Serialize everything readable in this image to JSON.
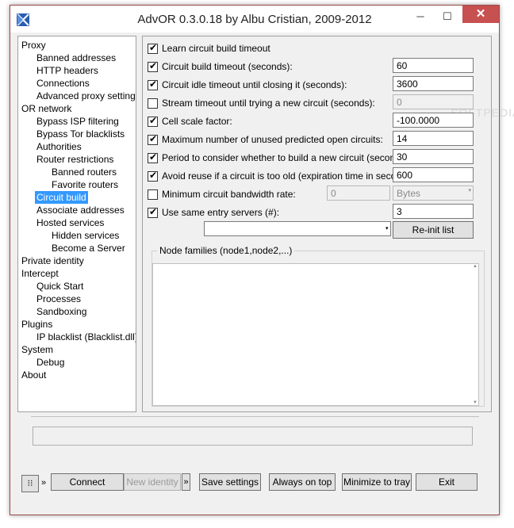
{
  "window": {
    "title": "AdvOR  0.3.0.18 by Albu Cristian, 2009-2012",
    "minimize_glyph": "─",
    "maximize_glyph": "☐",
    "close_glyph": "✕"
  },
  "watermark": "SOFTPEDIA",
  "tree": {
    "items": [
      {
        "label": "Proxy",
        "indent": 0
      },
      {
        "label": "Banned addresses",
        "indent": 1
      },
      {
        "label": "HTTP headers",
        "indent": 1
      },
      {
        "label": "Connections",
        "indent": 1
      },
      {
        "label": "Advanced proxy settings",
        "indent": 1
      },
      {
        "label": "OR network",
        "indent": 0
      },
      {
        "label": "Bypass ISP filtering",
        "indent": 1
      },
      {
        "label": "Bypass Tor blacklists",
        "indent": 1
      },
      {
        "label": "Authorities",
        "indent": 1
      },
      {
        "label": "Router restrictions",
        "indent": 1
      },
      {
        "label": "Banned routers",
        "indent": 2
      },
      {
        "label": "Favorite routers",
        "indent": 2
      },
      {
        "label": "Circuit build",
        "indent": 1,
        "selected": true
      },
      {
        "label": "Associate addresses",
        "indent": 1
      },
      {
        "label": "Hosted services",
        "indent": 1
      },
      {
        "label": "Hidden services",
        "indent": 2
      },
      {
        "label": "Become a Server",
        "indent": 2
      },
      {
        "label": "Private identity",
        "indent": 0
      },
      {
        "label": "Intercept",
        "indent": 0
      },
      {
        "label": "Quick Start",
        "indent": 1
      },
      {
        "label": "Processes",
        "indent": 1
      },
      {
        "label": "Sandboxing",
        "indent": 1
      },
      {
        "label": "Plugins",
        "indent": 0
      },
      {
        "label": "IP blacklist (Blacklist.dll)",
        "indent": 1
      },
      {
        "label": "System",
        "indent": 0
      },
      {
        "label": "Debug",
        "indent": 1
      },
      {
        "label": "About",
        "indent": 0
      }
    ]
  },
  "settings": {
    "learn_timeout": {
      "label": "Learn circuit build timeout",
      "checked": true
    },
    "build_timeout": {
      "label": "Circuit build timeout (seconds):",
      "checked": true,
      "value": "60"
    },
    "idle_timeout": {
      "label": "Circuit idle timeout until closing it (seconds):",
      "checked": true,
      "value": "3600"
    },
    "stream_timeout": {
      "label": "Stream timeout until trying a new circuit (seconds):",
      "checked": false,
      "value": "0"
    },
    "scale_factor": {
      "label": "Cell scale factor:",
      "checked": true,
      "value": "-100.0000"
    },
    "max_unused": {
      "label": "Maximum number of unused predicted open circuits:",
      "checked": true,
      "value": "14"
    },
    "period": {
      "label": "Period to consider whether to build a new circuit (seconds)",
      "checked": true,
      "value": "30"
    },
    "avoid_reuse": {
      "label": "Avoid reuse if a circuit is too old (expiration time in seconds",
      "checked": true,
      "value": "600"
    },
    "min_bandwidth": {
      "label": "Minimum circuit bandwidth rate:",
      "checked": false,
      "value": "0",
      "unit": "Bytes"
    },
    "entry_servers": {
      "label": "Use same entry servers (#):",
      "checked": true,
      "value": "3"
    },
    "entry_list_value": "",
    "reinit_label": "Re-init list",
    "node_families_legend": "Node families (node1,node2,...)",
    "node_families_value": ""
  },
  "status_text": "",
  "footer": {
    "toolbar_glyph": "⁝⁝",
    "more_glyph": "»",
    "connect": "Connect",
    "new_identity": "New identity",
    "save_settings": "Save settings",
    "always_on_top": "Always on top",
    "minimize_tray": "Minimize to tray",
    "exit": "Exit"
  }
}
